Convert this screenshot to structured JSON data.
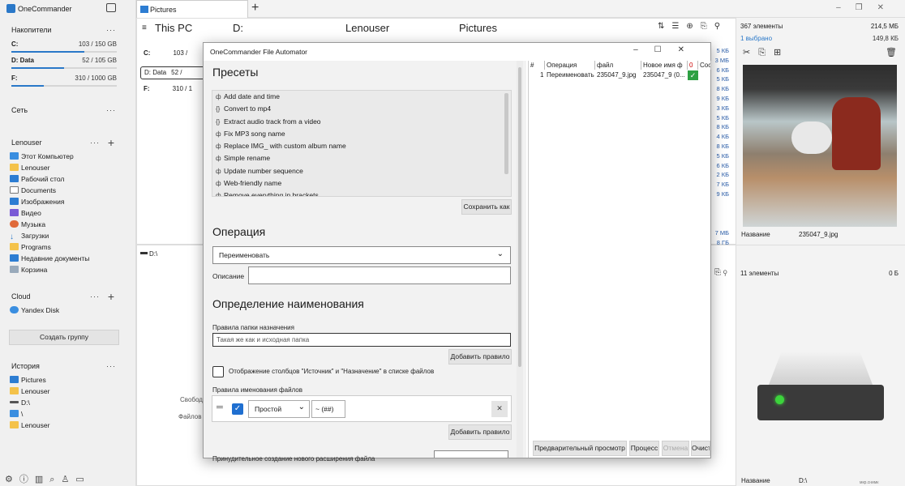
{
  "app": {
    "title": "OneCommander",
    "active_tab": "Pictures"
  },
  "sidebar": {
    "drives_title": "Накопители",
    "drives": [
      {
        "name": "C:",
        "size": "103 / 150 GB",
        "fill": 0.69
      },
      {
        "name": "D: Data",
        "size": "52 / 105 GB",
        "fill": 0.5
      },
      {
        "name": "F:",
        "size": "310 / 1000 GB",
        "fill": 0.31
      }
    ],
    "network_title": "Сеть",
    "favorites_title": "Lenouser",
    "favorites": [
      "Этот Компьютер",
      "Lenouser",
      "Рабочий стол",
      "Documents",
      "Изображения",
      "Видео",
      "Музыка",
      "Загрузки",
      "Programs",
      "Недавние документы",
      "Корзина"
    ],
    "cloud_title": "Cloud",
    "cloud_items": [
      "Yandex Disk"
    ],
    "create_group": "Создать группу",
    "history_title": "История",
    "history": [
      "Pictures",
      "Lenouser",
      "D:\\",
      "\\",
      "Lenouser"
    ]
  },
  "columns": {
    "col1": "This PC",
    "col2": "D:",
    "col3": "Lenouser",
    "col4": "Pictures",
    "col1_drives": [
      "C:",
      "D: Data",
      "F:"
    ],
    "col1_sizes": [
      "103 /",
      "52 /",
      "310 / 1"
    ],
    "lower_path": "D:\\",
    "free_label": "Свобод",
    "files_label": "Файлов"
  },
  "sizes": [
    "5 КБ",
    "3 МБ",
    "6 КБ",
    "5 КБ",
    "8 КБ",
    "9 КБ",
    "3 КБ",
    "5 КБ",
    "8 КБ",
    "4 КБ",
    "8 КБ",
    "5 КБ",
    "6 КБ",
    "2 КБ",
    "7 КБ",
    "9 КБ",
    "7 МБ",
    "8 ГБ",
    "3 МБ",
    "2 ГБ",
    "1 МБ",
    "5 МБ",
    "9 ГБ",
    "3 ГБ",
    "7 ГБ",
    "9 ГБ",
    "9 ГБ"
  ],
  "right": {
    "count": "367 элементы",
    "total": "214,5 МБ",
    "selected": "1 выбрано",
    "selected_size": "149,8 КБ",
    "name_label": "Название",
    "file_name": "235047_9.jpg",
    "count2": "11 элементы",
    "size2": "0 Б",
    "name_label2": "Название",
    "drive_name": "D:\\",
    "footer_small": "мкр.снимк"
  },
  "dialog": {
    "title": "OneCommander File Automator",
    "presets_title": "Пресеты",
    "presets": [
      {
        "icon": "ф",
        "label": "Add date and time"
      },
      {
        "icon": "{}",
        "label": "Convert to mp4"
      },
      {
        "icon": "{}",
        "label": "Extract audio track from a video"
      },
      {
        "icon": "ф",
        "label": "Fix MP3 song name"
      },
      {
        "icon": "ф",
        "label": "Replace IMG_ with custom album name"
      },
      {
        "icon": "ф",
        "label": "Simple rename"
      },
      {
        "icon": "ф",
        "label": "Update number sequence"
      },
      {
        "icon": "ф",
        "label": "Web-friendly name"
      },
      {
        "icon": "ф",
        "label": "Remove everything in brackets"
      }
    ],
    "save_as": "Сохранить как",
    "operation_title": "Операция",
    "operation_value": "Переименовать",
    "description_label": "Описание",
    "naming_title": "Определение наименования",
    "dest_rules_label": "Правила папки назначения",
    "dest_placeholder": "Такая же как и исходная папка",
    "add_rule": "Добавить правило",
    "show_columns": "Отображение столбцов \"Источник\" и \"Назначение\" в списке файлов",
    "file_rules_label": "Правила именования файлов",
    "rule_type": "Простой",
    "rule_pattern": "~ (##)",
    "add_rule2": "Добавить правило",
    "force_ext": "Принудительное создание нового расширения файла",
    "grid_headers": [
      "#",
      "Операция",
      "файл",
      "Новое имя ф",
      "0",
      "Сос"
    ],
    "grid_row": {
      "num": "1",
      "op": "Переименовать",
      "file": "235047_9.jpg",
      "new": "235047_9 (0...",
      "zero": ""
    },
    "preview": "Предварительный просмотр",
    "process": "Процесс",
    "cancel": "Отмена",
    "clear": "Очист"
  }
}
